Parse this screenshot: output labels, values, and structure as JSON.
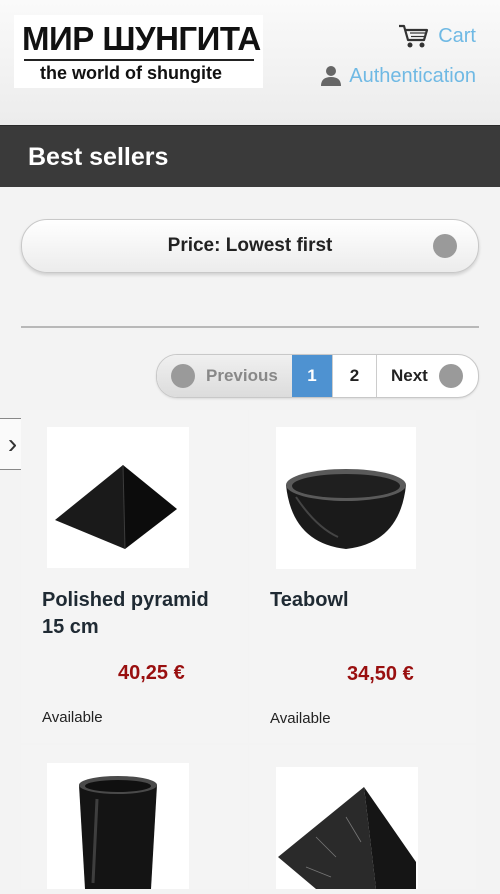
{
  "header": {
    "logo_top": "МИР ШУНГИТА",
    "logo_bottom": "the world of shungite",
    "cart_label": "Cart",
    "auth_label": "Authentication"
  },
  "page": {
    "title": "Best sellers"
  },
  "sort": {
    "label": "Price: Lowest first"
  },
  "pagination": {
    "prev": "Previous",
    "current": "1",
    "page2": "2",
    "next": "Next"
  },
  "products": [
    {
      "name": "Polished pyramid 15 cm",
      "price": "40,25 €",
      "availability": "Available"
    },
    {
      "name": "Teabowl",
      "price": "34,50 €",
      "availability": "Available"
    },
    {
      "name": "",
      "price": "",
      "availability": ""
    },
    {
      "name": "",
      "price": "",
      "availability": ""
    }
  ],
  "colors": {
    "accent_link": "#6fb9e4",
    "price": "#990f0f",
    "active_page": "#4e92d1",
    "title_bar": "#3a3a3a"
  },
  "icons": {
    "cart": "cart-icon",
    "auth": "user-icon",
    "side_tab": "chevron-right-icon"
  }
}
